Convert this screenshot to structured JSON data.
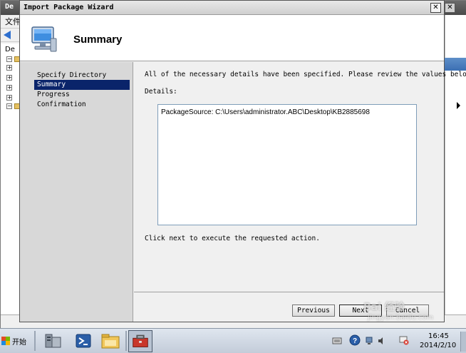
{
  "background_window": {
    "title": "De",
    "menu_file": "文件",
    "tree_label": "De",
    "close_glyph": "✕"
  },
  "wizard": {
    "title": "Import Package Wizard",
    "close_glyph": "✕",
    "header_title": "Summary",
    "header_icon": "computer-monitor-icon",
    "nav_items": [
      {
        "label": "Specify Directory",
        "selected": false
      },
      {
        "label": "Summary",
        "selected": true
      },
      {
        "label": "Progress",
        "selected": false
      },
      {
        "label": "Confirmation",
        "selected": false
      }
    ],
    "intro_text": "All of the necessary details have been specified.  Please review the values below.",
    "details_label": "Details:",
    "details_value": "PackageSource:  C:\\Users\\administrator.ABC\\Desktop\\KB2885698",
    "footer_text": "Click next to execute the requested action.",
    "buttons": {
      "previous": "Previous",
      "next": "Next",
      "cancel": "Cancel"
    }
  },
  "taskbar": {
    "start_label": "开始",
    "items": [
      "server-manager-icon",
      "powershell-icon",
      "file-explorer-icon",
      "toolbox-icon"
    ],
    "active_item": "toolbox-icon",
    "clock_time": "16:45",
    "clock_date": "2014/2/10"
  },
  "watermark": {
    "text": "Bai 经验",
    "sub": "jingyan.baidu.com"
  },
  "colors": {
    "selection": "#0a246a",
    "header_bg": "#ffffff",
    "nav_bg": "#d8d8d8"
  }
}
